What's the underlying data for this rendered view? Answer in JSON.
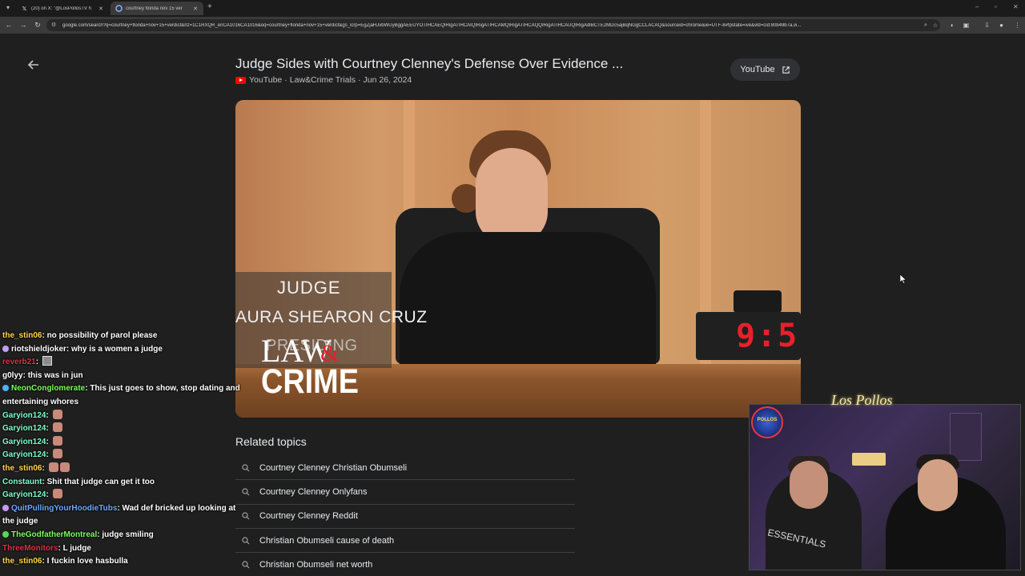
{
  "browser": {
    "tabs": [
      {
        "title": "(20) on X: \"@LosPollosTV h",
        "active": false,
        "icon": "x-logo-icon"
      },
      {
        "title": "courtney florida nov 15 ver",
        "active": true,
        "icon": "google-icon"
      }
    ],
    "url": "google.com/search?q=courtney+florida+nov+15+verdict&rlz=1C1RXQR_enCA1016CA1016&oq=courtney+florida+nov+15+verdict&gs_lcrp=EgZjaHJvbWUyBggAEEUYOTIHCAEQIRigATIHCAIQIRigATIHCAMQIRigATIHCAQQIRigATIHCAUQIRigAdIBCTE2MDc5ajBqNGgCCLACAQ&sourceid=chrome&ie=UTF-8#fpstate=ive&vld=cid:80b49b7a,vi..."
  },
  "page": {
    "video_title": "Judge Sides with Courtney Clenney's Defense Over Evidence ...",
    "source": "YouTube",
    "channel": "Law&Crime Trials",
    "date": "Jun 26, 2024",
    "youtube_button": "YouTube",
    "video_overlay": {
      "judge_label": "JUDGE",
      "judge_name": "AURA SHEARON CRUZ",
      "status": "PRESIDING",
      "clock": "9:5",
      "brand_top": "LAW",
      "brand_amp": "&",
      "brand_bottom": "CRIME"
    },
    "related_heading": "Related topics",
    "related_topics": [
      "Courtney Clenney Christian Obumseli",
      "Courtney Clenney Onlyfans",
      "Courtney Clenney Reddit",
      "Christian Obumseli cause of death",
      "Christian Obumseli net worth"
    ]
  },
  "chat": [
    {
      "user": "the_stin06",
      "color": "#ffd84a",
      "text": "no possibility of parol please",
      "badge": null
    },
    {
      "user": "riotshieldjoker",
      "color": "#ffffff",
      "text": "why is a women a judge",
      "badge": "#c79bff"
    },
    {
      "user": "reverb21",
      "color": "#e0304a",
      "text": "",
      "badge": null,
      "emote": "box"
    },
    {
      "user": "g0lyy",
      "color": "#ffffff",
      "text": "this was in jun",
      "badge": null
    },
    {
      "user": "NeonConglomerate",
      "color": "#7cff5c",
      "text": "This just goes to show, stop dating and entertaining whores",
      "badge": "#4ab4ff"
    },
    {
      "user": "Garyion124",
      "color": "#7fffd0",
      "text": "",
      "badge": null,
      "emote": "hand"
    },
    {
      "user": "Garyion124",
      "color": "#7fffd0",
      "text": "",
      "badge": null,
      "emote": "hand"
    },
    {
      "user": "Garyion124",
      "color": "#7fffd0",
      "text": "",
      "badge": null,
      "emote": "hand"
    },
    {
      "user": "Garyion124",
      "color": "#7fffd0",
      "text": "",
      "badge": null,
      "emote": "hand"
    },
    {
      "user": "the_stin06",
      "color": "#ffd84a",
      "text": "",
      "badge": null,
      "emote": "hands"
    },
    {
      "user": "Constaunt",
      "color": "#7fffd0",
      "text": "Shit that judge can get it too",
      "badge": null
    },
    {
      "user": "Garyion124",
      "color": "#7fffd0",
      "text": "",
      "badge": null,
      "emote": "hand"
    },
    {
      "user": "QuitPullingYourHoodieTubs",
      "color": "#6fa8ff",
      "text": "Wad def bricked up looking at the judge",
      "badge": "#c79bff"
    },
    {
      "user": "TheGodfatherMontreal",
      "color": "#7cff5c",
      "text": "judge smiling",
      "badge": "#5cd65c"
    },
    {
      "user": "ThreeMonitors",
      "color": "#e0304a",
      "text": "L judge",
      "badge": null
    },
    {
      "user": "the_stin06",
      "color": "#ffd84a",
      "text": "I fuckin love hasbulla",
      "badge": null
    }
  ],
  "webcam": {
    "sign": "Los Pollos",
    "shirt_text": "ESSENTIALS",
    "logo_text": "POLLOS"
  }
}
